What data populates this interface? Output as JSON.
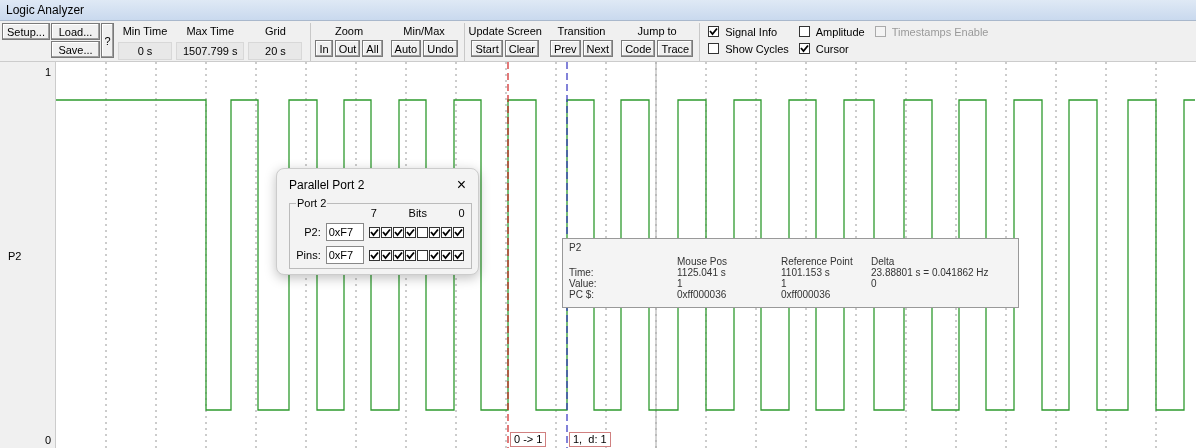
{
  "window": {
    "title": "Logic Analyzer"
  },
  "toolbar": {
    "file_buttons": {
      "setup": "Setup...",
      "load": "Load...",
      "save": "Save...",
      "help": "?"
    },
    "readouts": [
      {
        "label": "Min Time",
        "value": "0 s"
      },
      {
        "label": "Max Time",
        "value": "1507.799 s"
      },
      {
        "label": "Grid",
        "value": "20 s"
      }
    ],
    "groups": [
      {
        "label": "Zoom",
        "buttons": [
          "In",
          "Out",
          "All"
        ]
      },
      {
        "label": "Min/Max",
        "buttons": [
          "Auto",
          "Undo"
        ]
      },
      {
        "label": "Update Screen",
        "buttons": [
          "Start",
          "Clear"
        ]
      },
      {
        "label": "Transition",
        "buttons": [
          "Prev",
          "Next"
        ]
      },
      {
        "label": "Jump to",
        "buttons": [
          "Code",
          "Trace"
        ]
      }
    ],
    "checkboxes": [
      {
        "label": "Signal Info",
        "checked": true,
        "disabled": false
      },
      {
        "label": "Amplitude",
        "checked": false,
        "disabled": false
      },
      {
        "label": "Timestamps Enable",
        "checked": false,
        "disabled": true
      },
      {
        "label": "Show Cycles",
        "checked": false,
        "disabled": false
      },
      {
        "label": "Cursor",
        "checked": true,
        "disabled": false
      }
    ]
  },
  "plot": {
    "top_label": "1",
    "signal": "P2",
    "bottom_label": "0",
    "cursors": [
      {
        "kind": "reference",
        "label": "0 -> 1"
      },
      {
        "kind": "mouse",
        "label": "1,  d: 1"
      }
    ]
  },
  "dialog": {
    "title": "Parallel Port 2",
    "close": "×",
    "group": "Port 2",
    "bits_header": {
      "high": "7",
      "title": "Bits",
      "low": "0"
    },
    "rows": [
      {
        "label": "P2:",
        "value": "0xF7",
        "bits": [
          true,
          true,
          true,
          true,
          false,
          true,
          true,
          true
        ]
      },
      {
        "label": "Pins:",
        "value": "0xF7",
        "bits": [
          true,
          true,
          true,
          true,
          false,
          true,
          true,
          true
        ]
      }
    ]
  },
  "signal_info": {
    "signal": "P2",
    "columns": [
      "Mouse Pos",
      "Reference Point",
      "Delta"
    ],
    "rows": [
      {
        "label": "Time:",
        "cells": [
          "1125.041 s",
          "1101.153 s",
          "23.88801 s = 0.041862 Hz"
        ]
      },
      {
        "label": "Value:",
        "cells": [
          "1",
          "1",
          "0"
        ]
      },
      {
        "label": "PC $:",
        "cells": [
          "0xff000036",
          "0xff000036"
        ]
      }
    ]
  }
}
